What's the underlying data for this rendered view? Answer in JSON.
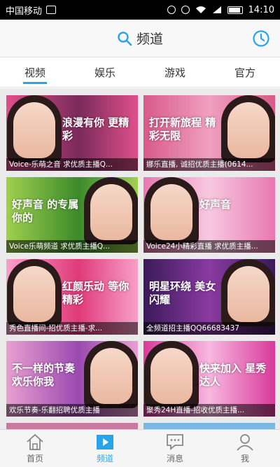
{
  "status_bar": {
    "carrier": "中国移动",
    "time": "14:10"
  },
  "header": {
    "title": "频道"
  },
  "tabs": [
    {
      "label": "视频",
      "active": true
    },
    {
      "label": "娱乐",
      "active": false
    },
    {
      "label": "游戏",
      "active": false
    },
    {
      "label": "官方",
      "active": false
    }
  ],
  "cards": [
    {
      "caption": "Voice-乐萌之音 求优质主播Q...",
      "banner": "浪漫有你 更精彩",
      "color1": "#7a2a5a",
      "color2": "#e0508a"
    },
    {
      "caption": "娜乐直播, 诚招优质主播(0614...",
      "banner": "打开新旅程 精彩无限",
      "color1": "#d85a8a",
      "color2": "#f0a0c0"
    },
    {
      "caption": "Voice乐萌频道 求优质主播Q...",
      "banner": "好声音 的专属你的",
      "color1": "#3c8a2a",
      "color2": "#a0d050"
    },
    {
      "caption": "Voice24小精彩直播 求优质主播...",
      "banner": "好声音",
      "color1": "#e878b0",
      "color2": "#f8c8e0"
    },
    {
      "caption": "秀色直播间-招优质主播-求...",
      "banner": "红颜乐动 等你精彩",
      "color1": "#e03a7a",
      "color2": "#f8a0c8"
    },
    {
      "caption": "全频道招主播QQ66683437",
      "banner": "明星环绕 美女闪耀",
      "color1": "#3a1a5a",
      "color2": "#8a3aa0"
    },
    {
      "caption": "欢乐节奏-乐翻招聘优质主播",
      "banner": "不一样的节奏 欢乐你我",
      "color1": "#9a4ab0",
      "color2": "#e8a0d0"
    },
    {
      "caption": "聚秀24H直播-招收优质主播...",
      "banner": "快来加入 星秀达人",
      "color1": "#d83a9a",
      "color2": "#f8b8e0"
    }
  ],
  "bottom_nav": [
    {
      "label": "首页",
      "icon": "home-icon",
      "active": false
    },
    {
      "label": "频道",
      "icon": "channel-icon",
      "active": true
    },
    {
      "label": "消息",
      "icon": "message-icon",
      "active": false
    },
    {
      "label": "我",
      "icon": "profile-icon",
      "active": false
    }
  ],
  "colors": {
    "accent": "#2aa4e8"
  }
}
